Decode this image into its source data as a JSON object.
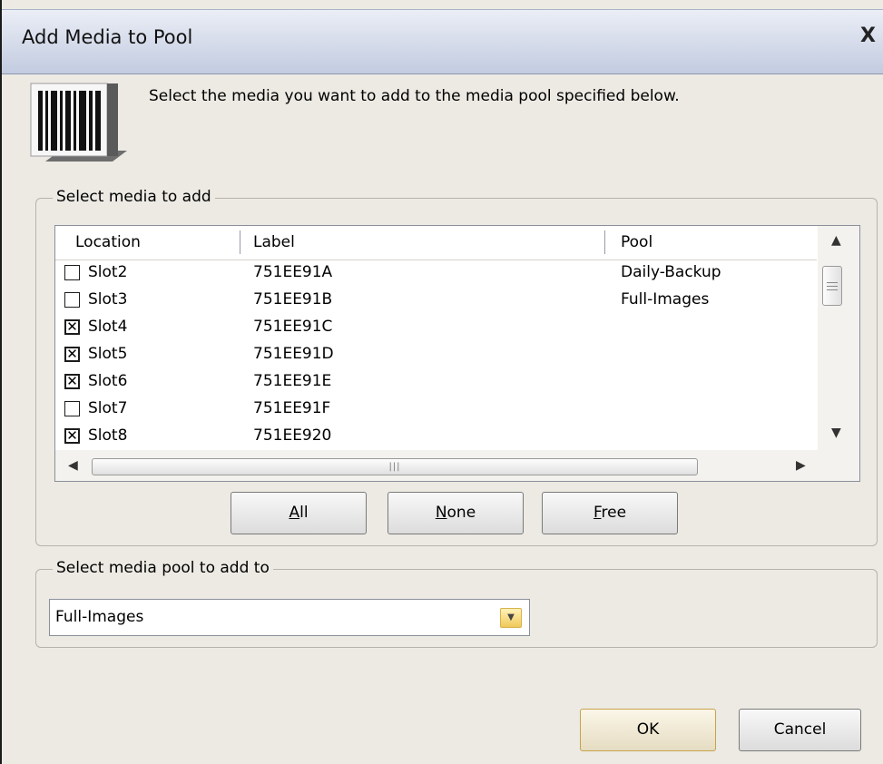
{
  "window": {
    "title": "Add Media to Pool",
    "close_glyph": "X"
  },
  "header": {
    "icon": "barcode-media-icon",
    "instruction": "Select the media you want to add to the media pool specified below."
  },
  "media_group": {
    "legend": "Select media to add",
    "columns": [
      "Location",
      "Label",
      "Pool"
    ],
    "rows": [
      {
        "checked": false,
        "location": "Slot2",
        "label": "751EE91A",
        "pool": "Daily-Backup"
      },
      {
        "checked": false,
        "location": "Slot3",
        "label": "751EE91B",
        "pool": "Full-Images"
      },
      {
        "checked": true,
        "location": "Slot4",
        "label": "751EE91C",
        "pool": ""
      },
      {
        "checked": true,
        "location": "Slot5",
        "label": "751EE91D",
        "pool": ""
      },
      {
        "checked": true,
        "location": "Slot6",
        "label": "751EE91E",
        "pool": ""
      },
      {
        "checked": false,
        "location": "Slot7",
        "label": "751EE91F",
        "pool": ""
      },
      {
        "checked": true,
        "location": "Slot8",
        "label": "751EE920",
        "pool": ""
      }
    ],
    "buttons": {
      "all": {
        "label": "All",
        "mnemonic": "A",
        "rest": "ll"
      },
      "none": {
        "label": "None",
        "mnemonic": "N",
        "rest": "one"
      },
      "free": {
        "label": "Free",
        "mnemonic": "F",
        "rest": "ree"
      }
    }
  },
  "pool_group": {
    "legend": "Select media pool to add to",
    "selected": "Full-Images"
  },
  "footer": {
    "ok_label": "OK",
    "cancel_label": "Cancel"
  }
}
